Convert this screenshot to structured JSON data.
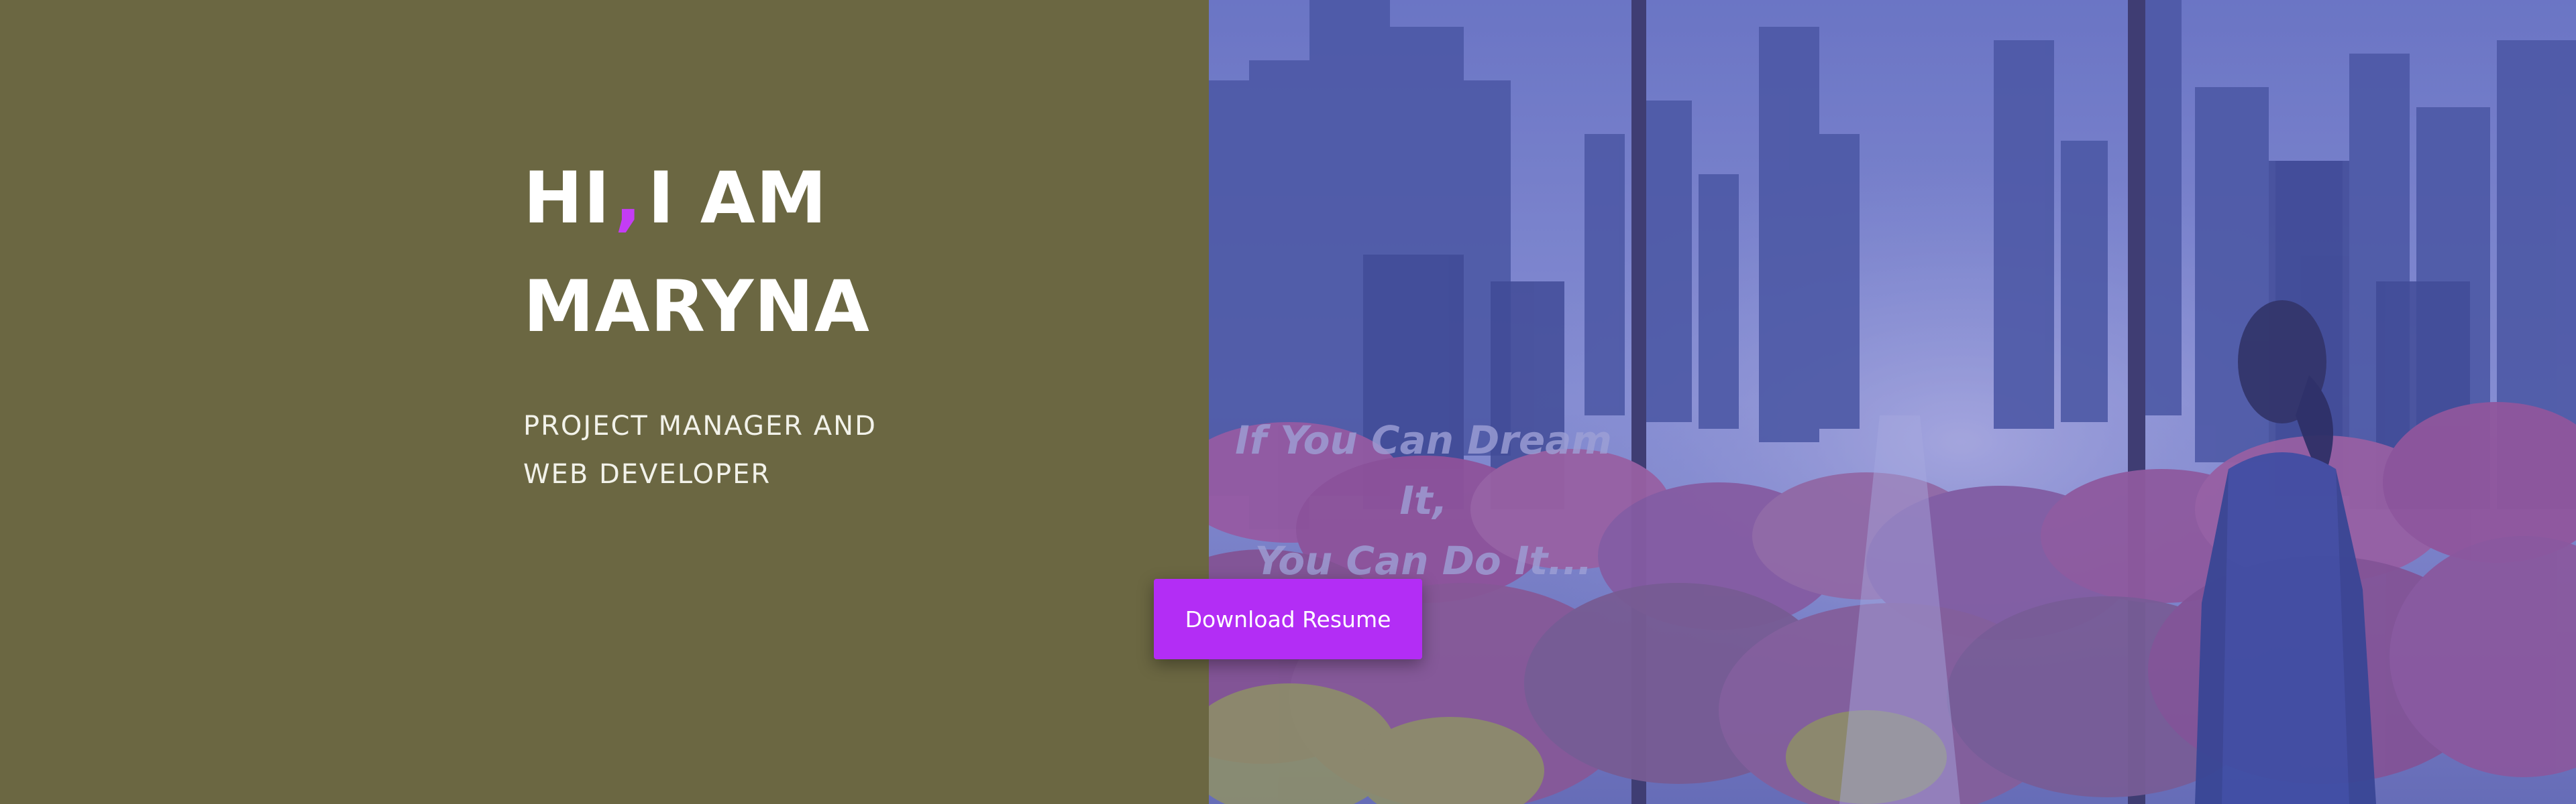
{
  "hero": {
    "greeting": "HI",
    "comma": ",",
    "intro": "I AM",
    "name": "MARYNA",
    "subtitle_line1": "PROJECT MANAGER AND",
    "subtitle_line2": "WEB DEVELOPER"
  },
  "hero_image": {
    "quote_line1": "If You Can Dream It,",
    "quote_line2": "You Can Do It..."
  },
  "actions": {
    "download_label": "Download Resume"
  },
  "colors": {
    "left_background": "#6b6742",
    "accent": "#b32df5",
    "comma_accent": "#c43cf5",
    "image_tint": "#5a62b8"
  }
}
